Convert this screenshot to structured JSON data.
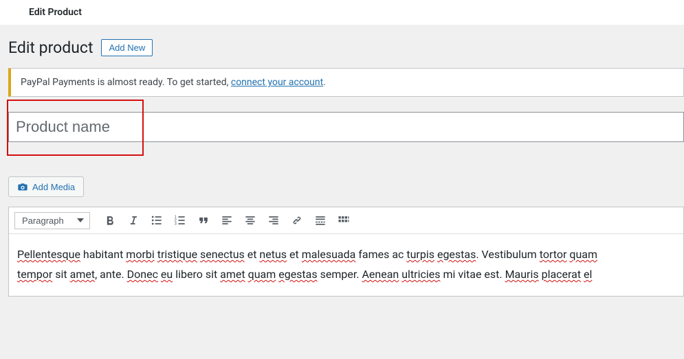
{
  "topTab": "Edit Product",
  "pageTitle": "Edit product",
  "addNewLabel": "Add New",
  "notice": {
    "text": "PayPal Payments is almost ready. To get started, ",
    "linkText": "connect your account",
    "tail": "."
  },
  "titlePlaceholder": "Product name",
  "addMediaLabel": "Add Media",
  "formatSelected": "Paragraph",
  "toolbarButtons": [
    "bold",
    "italic",
    "ul",
    "ol",
    "quote",
    "alignleft",
    "aligncenter",
    "alignright",
    "link",
    "more",
    "toolbar-toggle"
  ],
  "editorLine1": "Pellentesque habitant morbi tristique senectus et netus et malesuada fames ac turpis egestas. Vestibulum tortor quam",
  "editorLine2": "tempor sit amet, ante. Donec eu libero sit amet quam egestas semper. Aenean ultricies mi vitae est. Mauris placerat el"
}
